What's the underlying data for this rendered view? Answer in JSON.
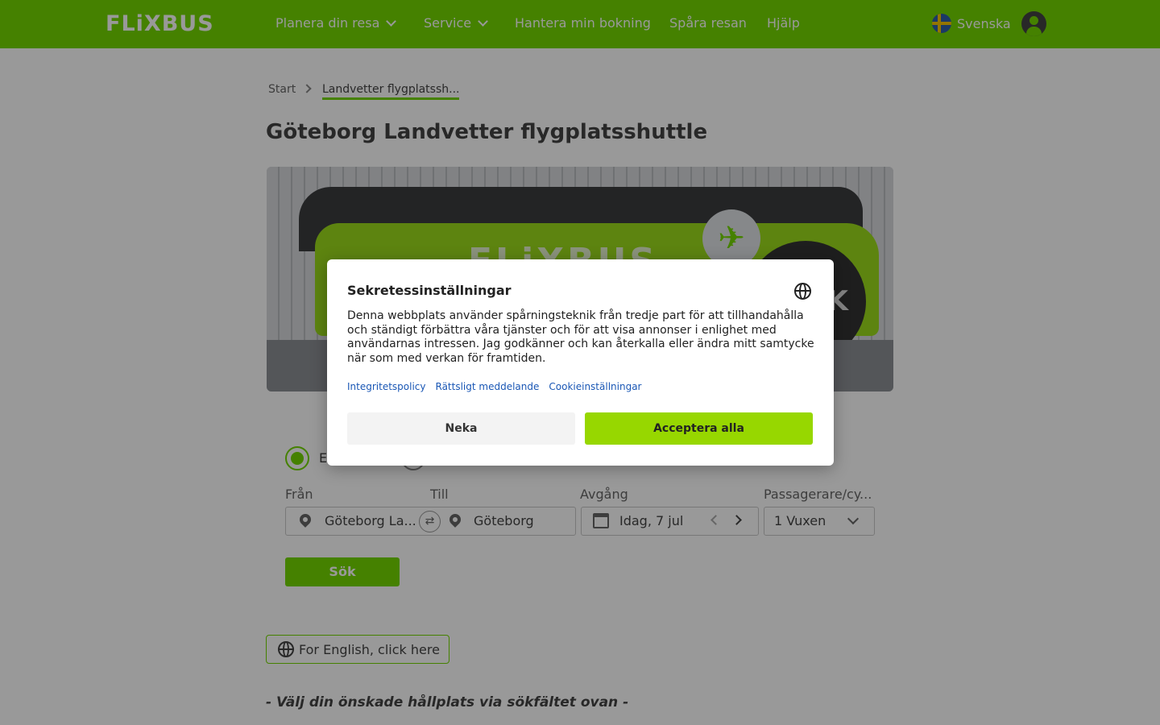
{
  "header": {
    "logo": "FLiXBUS",
    "nav": [
      {
        "label": "Planera din resa"
      },
      {
        "label": "Service"
      },
      {
        "label": "Hantera min bokning"
      },
      {
        "label": "Spåra resan"
      },
      {
        "label": "Hjälp"
      }
    ],
    "language": "Svenska"
  },
  "breadcrumb": {
    "start": "Start",
    "current": "Landvetter flygplatssh..."
  },
  "page_title": "Göteborg Landvetter flygplatsshuttle",
  "hero": {
    "bus_text": "FLiXBUS",
    "badge_text": "K"
  },
  "search": {
    "trip_type_label": "E",
    "from_label": "Från",
    "to_label": "Till",
    "departure_label": "Avgång",
    "passengers_label": "Passagerare/cy...",
    "from_value": "Göteborg La...",
    "to_value": "Göteborg",
    "departure_value": "Idag, 7 jul",
    "passengers_value": "1 Vuxen",
    "search_button": "Sök"
  },
  "english_button": "For English, click here",
  "note": "- Välj din önskade hållplats via sökfältet ovan -",
  "consent": {
    "title": "Sekretessinställningar",
    "text": "Denna webbplats använder spårningsteknik från tredje part för att tillhandahålla och ständigt förbättra våra tjänster och för att visa annonser i enlighet med användarnas intressen. Jag godkänner och kan återkalla eller ändra mitt samtycke när som med verkan för framtiden.",
    "links": [
      "Integritetspolicy",
      "Rättsligt meddelande",
      "Cookieinställningar"
    ],
    "deny": "Neka",
    "accept": "Acceptera alla"
  },
  "colors": {
    "brand_green": "#73d700",
    "accept_green": "#97d700",
    "link_blue": "#1a57b5"
  }
}
